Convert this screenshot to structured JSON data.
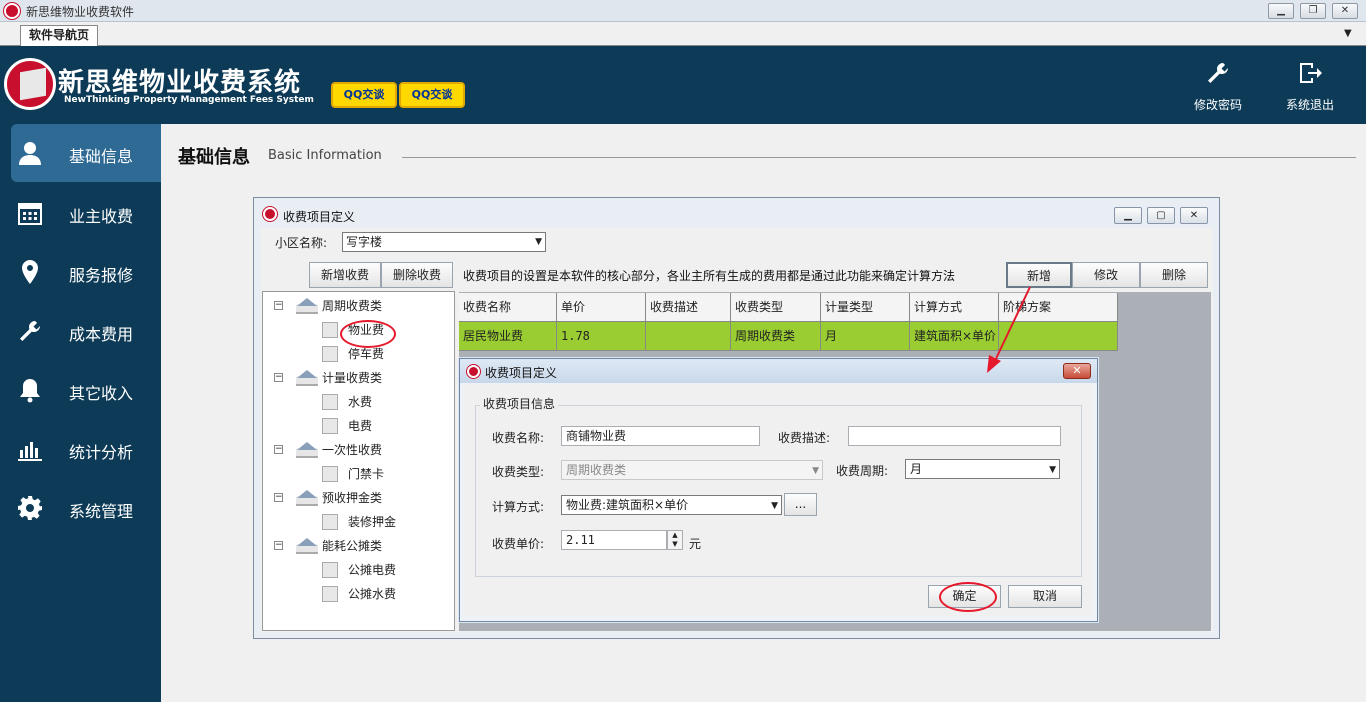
{
  "window": {
    "title": "新思维物业收费软件",
    "min": "▁",
    "restore": "❐",
    "close": "✕"
  },
  "tabs": {
    "active": "软件导航页",
    "dropdown": "▼"
  },
  "brand": {
    "cn": "新思维物业收费系统",
    "en": "NewThinking  Property Management Fees System"
  },
  "qq_buttons": [
    "QQ交谈",
    "QQ交谈"
  ],
  "header_actions": [
    {
      "label": "修改密码",
      "icon": "wrench-icon",
      "glyph": "🔧"
    },
    {
      "label": "系统退出",
      "icon": "exit-icon",
      "glyph": "⎋"
    }
  ],
  "sidebar": {
    "items": [
      {
        "label": "基础信息",
        "icon": "user-icon",
        "glyph": "👤",
        "active": true
      },
      {
        "label": "业主收费",
        "icon": "calendar-icon",
        "glyph": "▦"
      },
      {
        "label": "服务报修",
        "icon": "location-icon",
        "glyph": "⬤"
      },
      {
        "label": "成本费用",
        "icon": "wrench-icon",
        "glyph": "✎"
      },
      {
        "label": "其它收入",
        "icon": "bell-icon",
        "glyph": "🔔"
      },
      {
        "label": "统计分析",
        "icon": "bar-chart-icon",
        "glyph": "▐"
      },
      {
        "label": "系统管理",
        "icon": "gear-icon",
        "glyph": "⚙"
      }
    ]
  },
  "page": {
    "title": "基础信息",
    "subtitle": "Basic Information"
  },
  "fee_window": {
    "title": "收费项目定义",
    "community_label": "小区名称:",
    "community_value": "写字楼",
    "add_fee_button": "新增收费",
    "delete_fee_button": "删除收费",
    "description": "收费项目的设置是本软件的核心部分，各业主所有生成的费用都是通过此功能来确定计算方法",
    "new_button": "新增",
    "edit_button": "修改",
    "delete_button": "删除",
    "tree": [
      {
        "label": "周期收费类",
        "children": [
          "物业费",
          "停车费"
        ]
      },
      {
        "label": "计量收费类",
        "children": [
          "水费",
          "电费"
        ]
      },
      {
        "label": "一次性收费",
        "children": [
          "门禁卡"
        ]
      },
      {
        "label": "预收押金类",
        "children": [
          "装修押金"
        ]
      },
      {
        "label": "能耗公摊类",
        "children": [
          "公摊电费",
          "公摊水费"
        ]
      }
    ],
    "grid": {
      "columns": [
        "收费名称",
        "单价",
        "收费描述",
        "收费类型",
        "计量类型",
        "计算方式",
        "阶梯方案"
      ],
      "rows": [
        [
          "居民物业费",
          "1.78",
          "",
          "周期收费类",
          "月",
          "建筑面积×单价",
          ""
        ]
      ]
    }
  },
  "dialog": {
    "title": "收费项目定义",
    "close": "✕",
    "group_title": "收费项目信息",
    "name_label": "收费名称:",
    "name_value": "商铺物业费",
    "desc_label": "收费描述:",
    "desc_value": "",
    "type_label": "收费类型:",
    "type_value": "周期收费类",
    "period_label": "收费周期:",
    "period_value": "月",
    "calc_label": "计算方式:",
    "calc_value": "物业费:建筑面积×单价",
    "calc_more": "...",
    "price_label": "收费单价:",
    "price_value": "2.11",
    "price_unit": "元",
    "ok_button": "确定",
    "cancel_button": "取消"
  },
  "colors": {
    "header_bg": "#0d3b57",
    "active_nav": "#2e6a94",
    "row_highlight": "#9acd32",
    "annotation": "#e5192b"
  }
}
